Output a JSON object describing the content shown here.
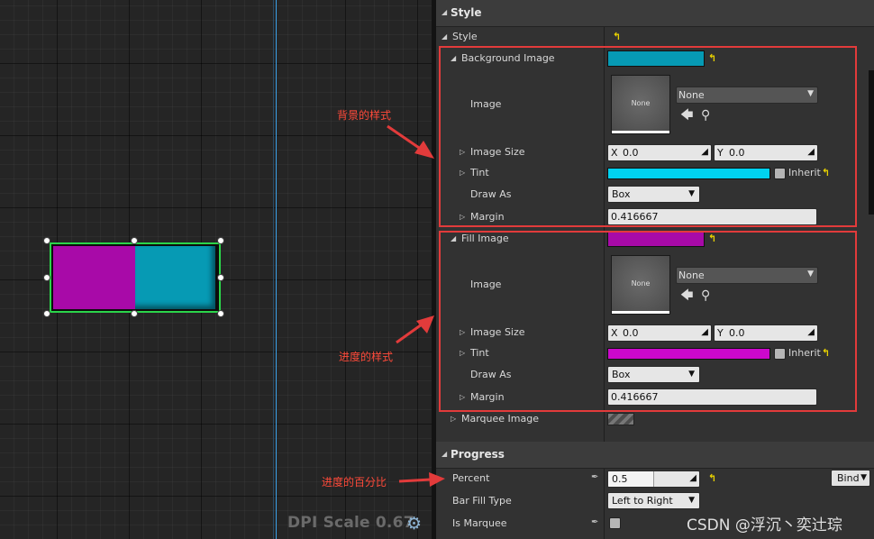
{
  "canvas": {
    "dpi_label": "DPI Scale 0.67",
    "settings_icon": "gear-icon",
    "widget_fill_color": "#a80aa8",
    "widget_background_color": "#069ab4",
    "selection_color": "#2bd44a",
    "progress_percent": 0.5
  },
  "details": {
    "style_section": {
      "header": "Style",
      "style_label": "Style",
      "background_image": {
        "label": "Background Image",
        "swatch_color": "#069ab4",
        "image_label": "Image",
        "thumb_text": "None",
        "asset_value": "None",
        "image_size_label": "Image Size",
        "size_x_axis": "X",
        "size_x": "0.0",
        "size_y_axis": "Y",
        "size_y": "0.0",
        "tint_label": "Tint",
        "tint_color": "#00d2f0",
        "inherit_label": "Inherit",
        "draw_as_label": "Draw As",
        "draw_as_value": "Box",
        "margin_label": "Margin",
        "margin_value": "0.416667"
      },
      "fill_image": {
        "label": "Fill Image",
        "swatch_color": "#a80aa8",
        "image_label": "Image",
        "thumb_text": "None",
        "asset_value": "None",
        "image_size_label": "Image Size",
        "size_x_axis": "X",
        "size_x": "0.0",
        "size_y_axis": "Y",
        "size_y": "0.0",
        "tint_label": "Tint",
        "tint_color": "#cc08cc",
        "inherit_label": "Inherit",
        "draw_as_label": "Draw As",
        "draw_as_value": "Box",
        "margin_label": "Margin",
        "margin_value": "0.416667"
      },
      "marquee_image_label": "Marquee Image"
    },
    "progress_section": {
      "header": "Progress",
      "percent_label": "Percent",
      "percent_value": "0.5",
      "percent_fraction": 0.5,
      "bind_label": "Bind",
      "bar_fill_type_label": "Bar Fill Type",
      "bar_fill_type_value": "Left to Right",
      "is_marquee_label": "Is Marquee"
    }
  },
  "annotations": {
    "background_style": "背景的样式",
    "progress_style": "进度的样式",
    "progress_percent": "进度的百分比",
    "color": "#e23b3b"
  },
  "watermark": "CSDN @浮沉丶奕辻琮"
}
